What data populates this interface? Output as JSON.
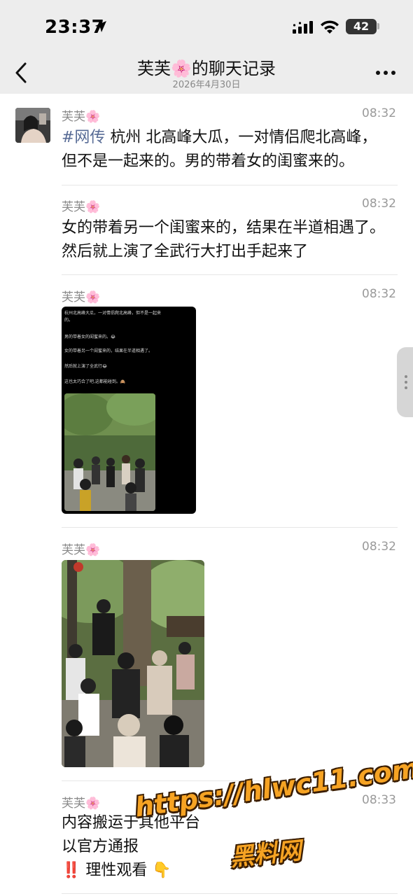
{
  "status": {
    "time": "23:37",
    "battery": "42"
  },
  "header": {
    "title": "芙芙🌸的聊天记录",
    "date": "2026年4月30日"
  },
  "messages": [
    {
      "sender": "芙芙🌸",
      "time": "08:32",
      "tag": "#网传",
      "text": " 杭州 北高峰大瓜，一对情侣爬北高峰，但不是一起来的。男的带着女的闺蜜来的。"
    },
    {
      "sender": "芙芙🌸",
      "time": "08:32",
      "text": "女的带着另一个闺蜜来的，结果在半道相遇了。然后就上演了全武行大打出手起来了"
    },
    {
      "sender": "芙芙🌸",
      "time": "08:32"
    },
    {
      "sender": "芙芙🌸",
      "time": "08:32"
    },
    {
      "sender": "芙芙🌸",
      "time": "08:33",
      "lines": [
        "内容搬运于其他平台",
        "以官方通报",
        "‼️ 理性观看 👇"
      ]
    }
  ],
  "image1_text": [
    "杭州北高峰大瓜，一对情侣爬北高峰，但不是一起来",
    "的。",
    "男的带着女的闺蜜来的。😂",
    "女的带着另一个闺蜜来的，结果在半道相遇了。",
    "然后就上演了全武行😂",
    "这也太巧合了吧,这都能碰到。🙈"
  ],
  "watermark": {
    "url": "https://hlwc11.com",
    "name": "黑料网"
  },
  "colors": {
    "background": "#ffffff",
    "header_bg": "#ededed",
    "tag": "#576b95",
    "watermark": "#f6a323"
  }
}
